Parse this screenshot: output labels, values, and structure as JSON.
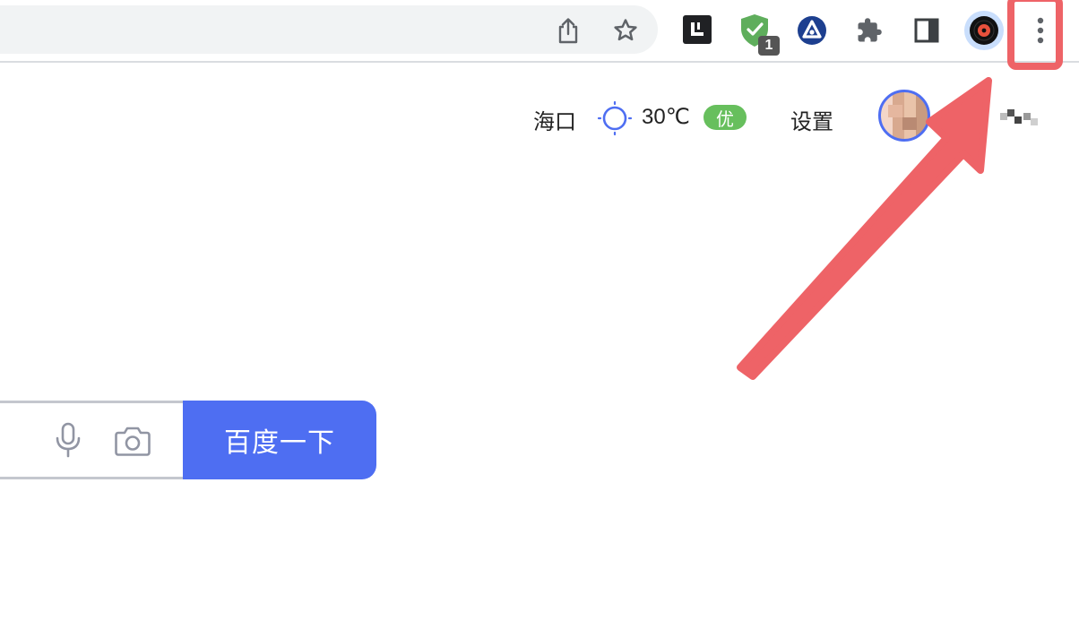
{
  "header": {
    "city": "海口",
    "temperature": "30℃",
    "air_quality": "优",
    "settings_label": "设置"
  },
  "toolbar": {
    "extension_badge_count": "1"
  },
  "search": {
    "button_label": "百度一下"
  },
  "colors": {
    "accent": "#4e6ef2",
    "aqi_good": "#67bf5d",
    "annotation": "#ee6367"
  },
  "icons": [
    "share-icon",
    "bookmark-star-icon",
    "extension-l-icon",
    "shield-check-icon",
    "triangle-circle-icon",
    "puzzle-icon",
    "side-panel-icon",
    "profile-avatar-icon",
    "more-menu-icon",
    "sun-icon",
    "user-avatar",
    "microphone-icon",
    "camera-icon"
  ]
}
